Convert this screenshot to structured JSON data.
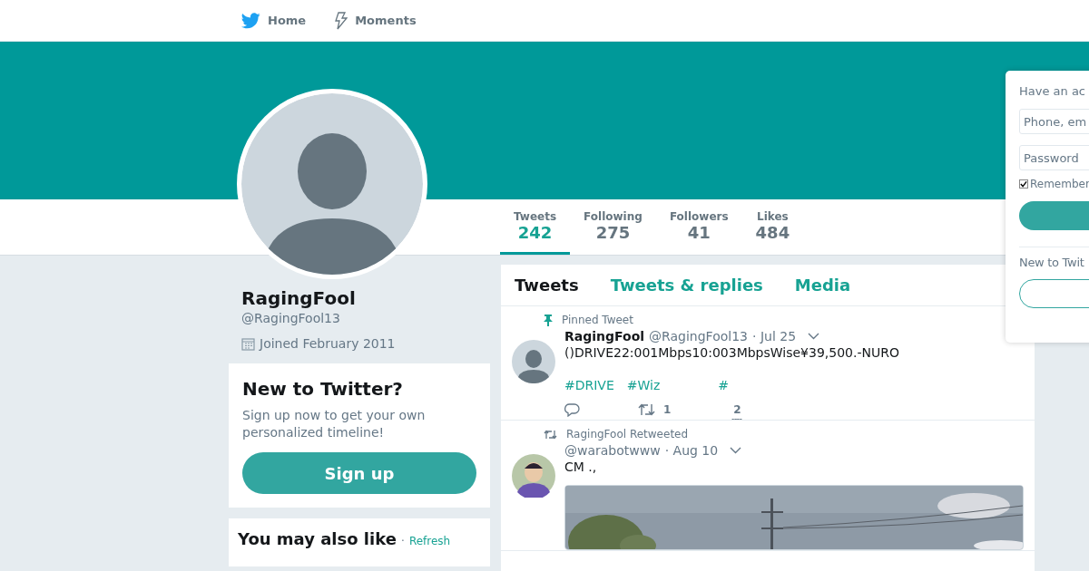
{
  "topnav": {
    "items": [
      {
        "label": "Home"
      },
      {
        "label": "Moments"
      }
    ]
  },
  "profile": {
    "name": "RagingFool",
    "handle": "@RagingFool13",
    "joined": "Joined February 2011"
  },
  "stats": [
    {
      "label": "Tweets",
      "value": "242",
      "selected": true
    },
    {
      "label": "Following",
      "value": "275",
      "selected": false
    },
    {
      "label": "Followers",
      "value": "41",
      "selected": false
    },
    {
      "label": "Likes",
      "value": "484",
      "selected": false
    }
  ],
  "signup_card": {
    "title": "New to Twitter?",
    "text": "Sign up now to get your own personalized timeline!",
    "button": "Sign up"
  },
  "suggestions": {
    "title": "You may also like",
    "separator": "·",
    "refresh": "Refresh"
  },
  "timeline_tabs": [
    {
      "label": "Tweets",
      "selected": true
    },
    {
      "label": "Tweets & replies",
      "selected": false
    },
    {
      "label": "Media",
      "selected": false
    }
  ],
  "tweets": [
    {
      "kind": "pinned",
      "context": "Pinned Tweet",
      "name": "RagingFool",
      "handle": "@RagingFool13",
      "date": "· Jul 25",
      "text": "()DRIVE22:001Mbps10:003MbpsWise¥39,500.-NURO",
      "hashtags": [
        "#DRIVE",
        "#Wiz",
        "#"
      ],
      "retweets": "1",
      "likes": "2"
    },
    {
      "kind": "retweet",
      "context": "RagingFool Retweeted",
      "handle": "@warabotwww",
      "date": "· Aug 10",
      "text": "CM  .,"
    }
  ],
  "login": {
    "title": "Have an ac",
    "phone_placeholder": "Phone, em",
    "password_placeholder": "Password",
    "remember": "Remember",
    "remember_checked": true,
    "new_label": "New to Twit"
  }
}
